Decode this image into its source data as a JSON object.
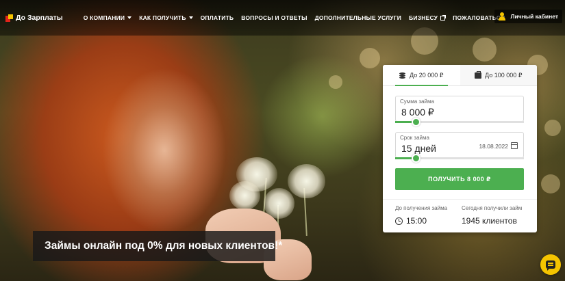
{
  "header": {
    "logo_text": "До Зарплаты",
    "nav": [
      {
        "label": "О КОМПАНИИ",
        "dropdown": true
      },
      {
        "label": "КАК ПОЛУЧИТЬ",
        "dropdown": true
      },
      {
        "label": "ОПЛАТИТЬ"
      },
      {
        "label": "ВОПРОСЫ И ОТВЕТЫ"
      },
      {
        "label": "ДОПОЛНИТЕЛЬНЫЕ УСЛУГИ"
      },
      {
        "label": "БИЗНЕСУ",
        "external": true
      },
      {
        "label": "ПОЖАЛОВАТЬСЯ"
      }
    ],
    "account_label": "Личный кабинет"
  },
  "promo": {
    "text": "Займы онлайн под 0% для новых клиентов!*"
  },
  "calculator": {
    "tabs": [
      {
        "label": "До 20 000 ₽",
        "icon": "coins-icon",
        "active": true
      },
      {
        "label": "До 100 000 ₽",
        "icon": "briefcase-icon",
        "active": false
      }
    ],
    "amount": {
      "label": "Сумма займа",
      "value": "8 000 ₽",
      "level": 0.16
    },
    "term": {
      "label": "Срок займа",
      "value": "15 дней",
      "date": "18.08.2022",
      "level": 0.16
    },
    "submit_label": "ПОЛУЧИТЬ 8 000 ₽",
    "stats": {
      "until_label": "До получения займа",
      "until_value": "15:00",
      "today_label": "Сегодня получили займ",
      "today_value": "1945 клиентов"
    }
  },
  "colors": {
    "accent_green": "#4caf50",
    "brand_yellow": "#f5c400",
    "brand_red": "#e2231a"
  }
}
